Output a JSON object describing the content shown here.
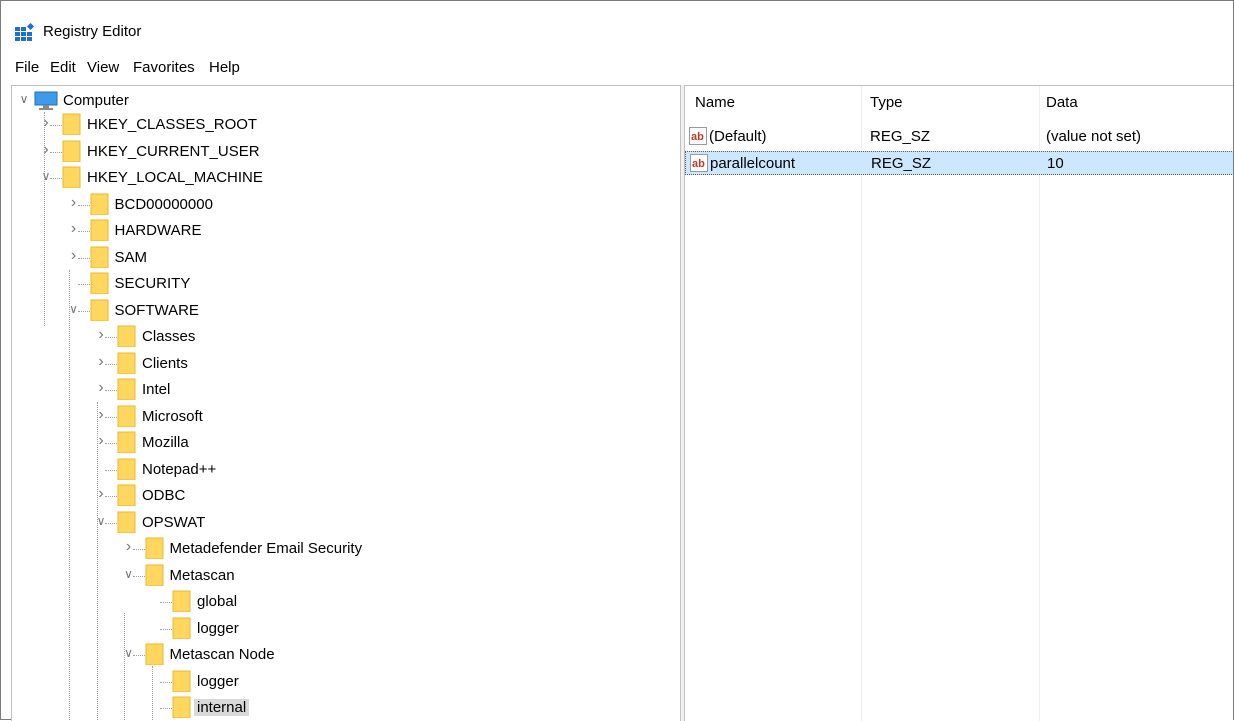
{
  "window": {
    "title": "Registry Editor"
  },
  "menu": [
    "File",
    "Edit",
    "View",
    "Favorites",
    "Help"
  ],
  "tree": {
    "root": "Computer",
    "nodes": [
      {
        "label": "HKEY_CLASSES_ROOT",
        "expanded": false
      },
      {
        "label": "HKEY_CURRENT_USER",
        "expanded": false
      },
      {
        "label": "HKEY_LOCAL_MACHINE",
        "expanded": true
      },
      {
        "label": "BCD00000000",
        "expanded": false
      },
      {
        "label": "HARDWARE",
        "expanded": false
      },
      {
        "label": "SAM",
        "expanded": false
      },
      {
        "label": "SECURITY"
      },
      {
        "label": "SOFTWARE",
        "expanded": true
      },
      {
        "label": "Classes",
        "expanded": false
      },
      {
        "label": "Clients",
        "expanded": false
      },
      {
        "label": "Intel",
        "expanded": false
      },
      {
        "label": "Microsoft",
        "expanded": false
      },
      {
        "label": "Mozilla",
        "expanded": false
      },
      {
        "label": "Notepad++"
      },
      {
        "label": "ODBC",
        "expanded": false
      },
      {
        "label": "OPSWAT",
        "expanded": true
      },
      {
        "label": "Metadefender Email Security",
        "expanded": false
      },
      {
        "label": "Metascan",
        "expanded": true
      },
      {
        "label": "global"
      },
      {
        "label": "logger"
      },
      {
        "label": "Metascan Node",
        "expanded": true
      },
      {
        "label": "logger"
      },
      {
        "label": "internal",
        "selected": true
      }
    ]
  },
  "list": {
    "columns": [
      "Name",
      "Type",
      "Data"
    ],
    "rows": [
      {
        "name": "(Default)",
        "type": "REG_SZ",
        "data": "(value not set)"
      },
      {
        "name": "parallelcount",
        "type": "REG_SZ",
        "data": "10",
        "selected": true
      }
    ]
  },
  "colors": {
    "selection": "#cce8ff",
    "folder": "#ffd75e",
    "tree_selected": "#d9d9d9"
  }
}
